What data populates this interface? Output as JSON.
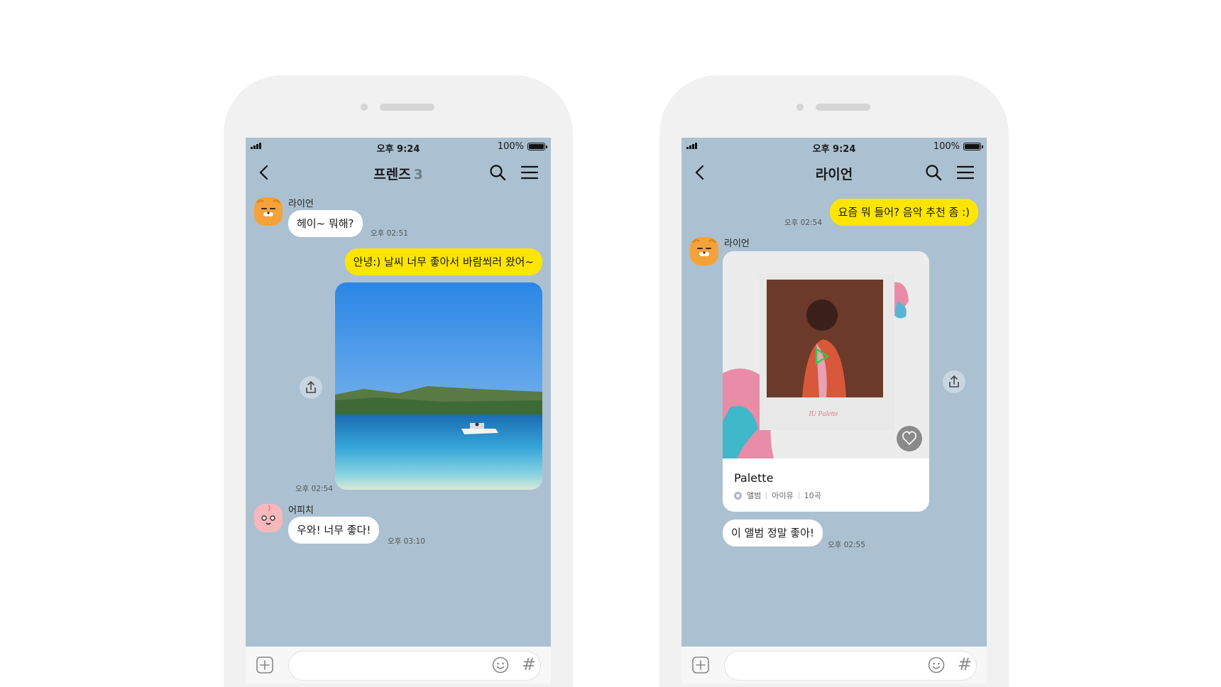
{
  "phones": [
    {
      "status": {
        "time": "오후 9:24",
        "battery": "100%"
      },
      "title": "프렌즈",
      "member_count": "3",
      "messages": {
        "m1": {
          "sender": "라이언",
          "text": "헤이~ 뭐해?",
          "time": "오후 02:51"
        },
        "m2": {
          "text": "안녕:) 날씨 너무 좋아서 바람쐬러 왔어~",
          "time": "오후 02:54"
        },
        "m3": {
          "sender": "어피치",
          "text": "우와! 너무 좋다!",
          "time": "오후 03:10"
        }
      }
    },
    {
      "status": {
        "time": "오후 9:24",
        "battery": "100%"
      },
      "title": "라이언",
      "messages": {
        "m1": {
          "text": "요즘 뭐 들어? 음악 추천 좀 :)",
          "time": "오후 02:54"
        },
        "m2": {
          "sender": "라이언"
        },
        "album": {
          "title": "Palette",
          "type": "앨범",
          "artist": "아이유",
          "tracks": "10곡",
          "cover_text": "IU Palette"
        },
        "m3": {
          "text": "이 앨범 정말 좋아!",
          "time": "오후 02:55"
        }
      }
    }
  ],
  "icons": {
    "back": "chevron-left-icon",
    "search": "search-icon",
    "menu": "hamburger-icon",
    "share": "share-icon",
    "plus": "plus-square-icon",
    "emoji": "smile-icon",
    "hash": "#",
    "like": "heart-icon",
    "play": "play-icon"
  },
  "colors": {
    "chat_bg": "#abc1d1",
    "my_bubble": "#fee500",
    "their_bubble": "#ffffff",
    "phone_frame": "#f1f1f1"
  }
}
